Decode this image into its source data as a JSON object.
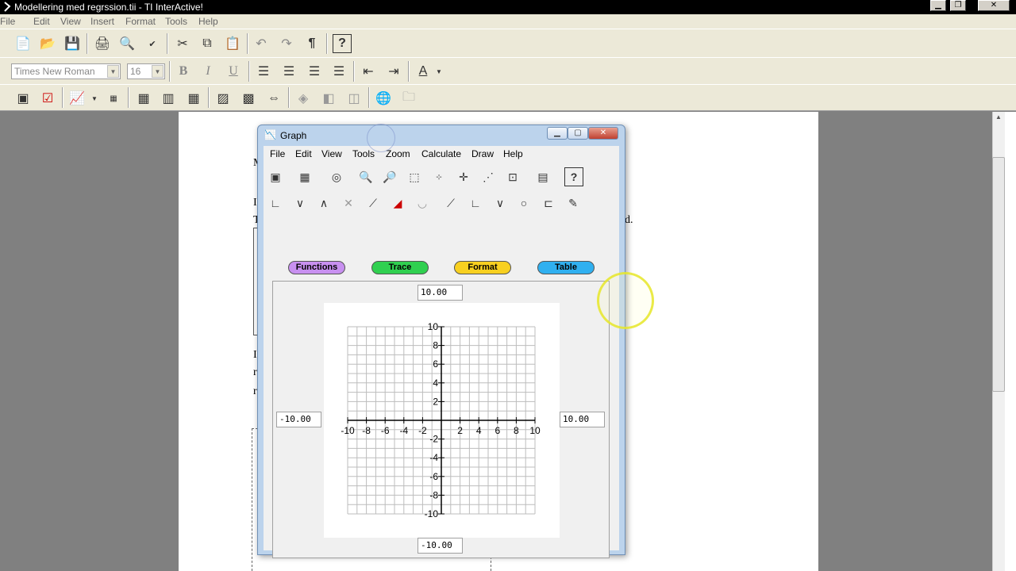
{
  "app": {
    "title": "Modellering med regrssion.tii - TI InterActive!",
    "menu": [
      "File",
      "Edit",
      "View",
      "Insert",
      "Format",
      "Tools",
      "Help"
    ],
    "font_combo": "Times New Roman",
    "size_combo": "16"
  },
  "graph": {
    "title": "Graph",
    "menu": [
      "File",
      "Edit",
      "View",
      "Tools",
      "Zoom",
      "Calculate",
      "Draw",
      "Help"
    ],
    "buttons": [
      {
        "label": "Functions",
        "color": "#c890f0"
      },
      {
        "label": "Trace",
        "color": "#30d050"
      },
      {
        "label": "Format",
        "color": "#f8d020"
      },
      {
        "label": "Table",
        "color": "#30b0f0"
      }
    ],
    "ymax": "10.00",
    "ymin": "-10.00",
    "xmin": "-10.00",
    "xmax": "10.00",
    "x_ticks": [
      "-10",
      "-8",
      "-6",
      "-4",
      "-2",
      "2",
      "4",
      "6",
      "8",
      "10"
    ],
    "y_ticks": [
      "10",
      "8",
      "6",
      "4",
      "2",
      "-2",
      "-4",
      "-6",
      "-8",
      "-10"
    ]
  },
  "doc": {
    "fragments": [
      "M",
      "I",
      "T",
      "d.",
      "I",
      "r",
      "r"
    ]
  }
}
